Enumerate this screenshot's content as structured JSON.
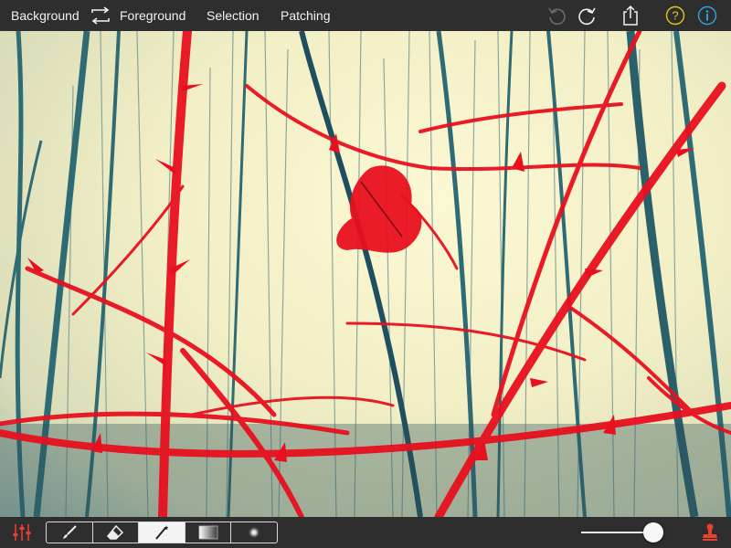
{
  "toolbar": {
    "background_label": "Background",
    "foreground_label": "Foreground",
    "selection_label": "Selection",
    "patching_label": "Patching",
    "icons": [
      "swap-icon",
      "undo-icon",
      "redo-icon",
      "share-icon",
      "help-icon",
      "info-icon"
    ]
  },
  "bottom_bar": {
    "tools": [
      "brush-icon",
      "eraser-icon",
      "magic-wand-icon",
      "gradient-icon",
      "soft-dot-icon"
    ],
    "active_tool": "magic-wand-icon",
    "brush_size_level": 0.85
  },
  "colors": {
    "bar_background": "#2e2e2e",
    "selection_overlay": "#e8101f",
    "help_icon": "#e5c619",
    "info_icon": "#2aa3e0",
    "stamp_icon": "#e8412e"
  }
}
